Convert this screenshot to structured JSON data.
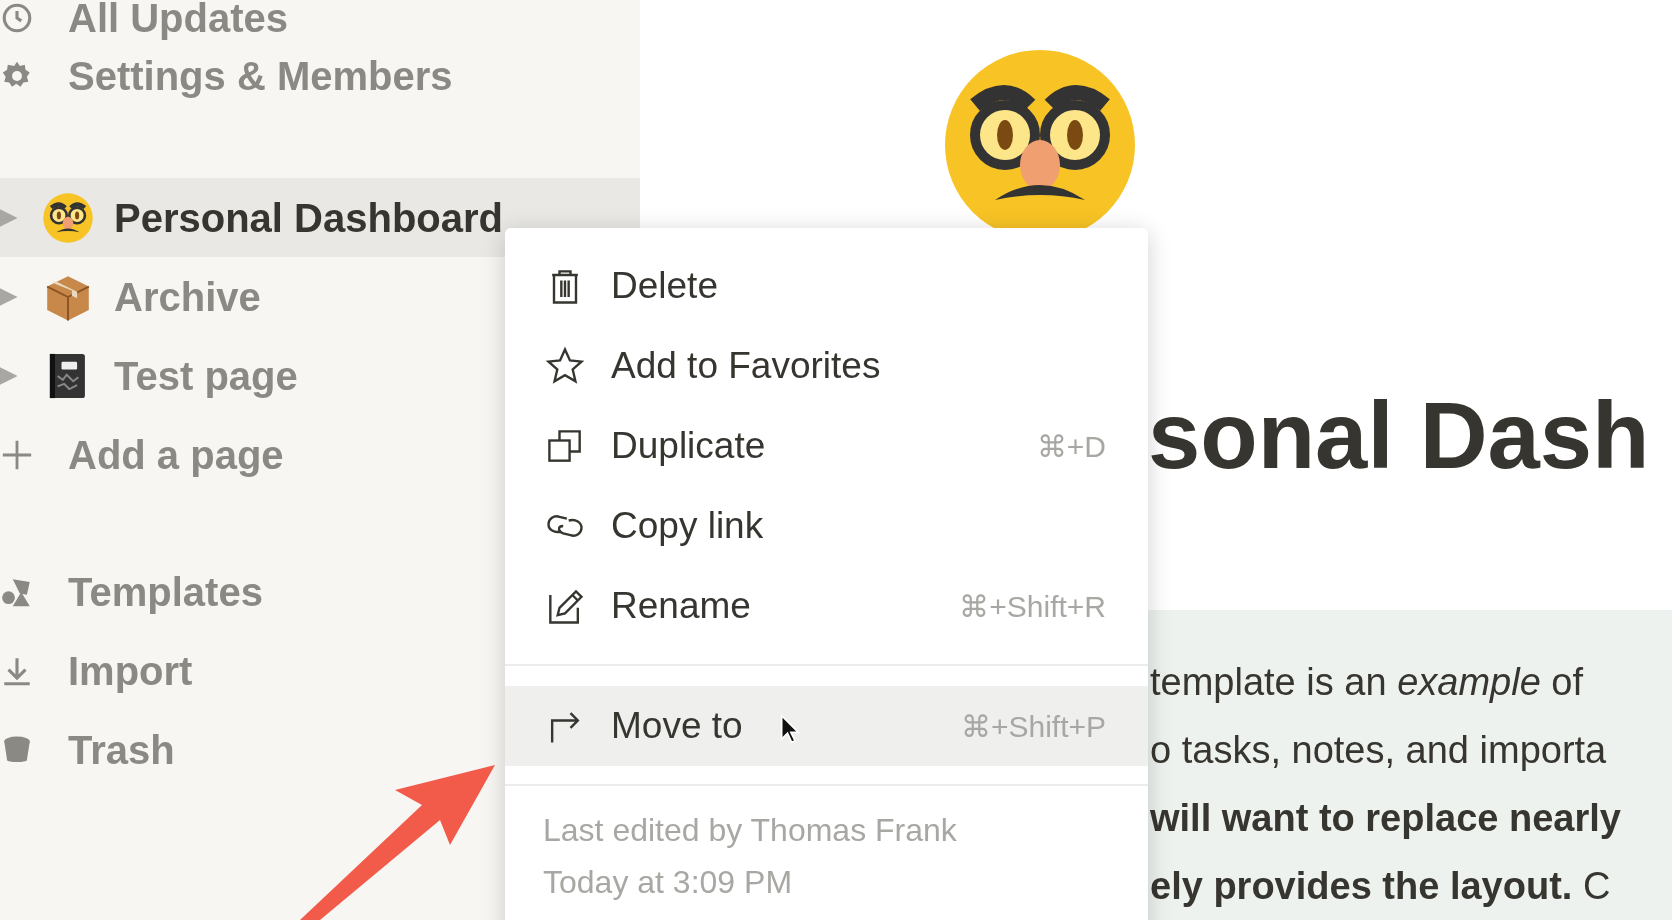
{
  "sidebar": {
    "top_item": {
      "kind": "clock",
      "label": "All Updates"
    },
    "nav_items": [
      {
        "kind": "gear",
        "label": "Settings & Members"
      }
    ],
    "pages": [
      {
        "kind": "disguise",
        "label": "Personal Dashboard",
        "selected": true
      },
      {
        "kind": "box",
        "label": "Archive",
        "selected": false
      },
      {
        "kind": "notebook",
        "label": "Test page",
        "selected": false
      }
    ],
    "add_page": {
      "label": "Add a page"
    },
    "bottom_items": [
      {
        "kind": "templates",
        "label": "Templates"
      },
      {
        "kind": "import",
        "label": "Import"
      },
      {
        "kind": "trash",
        "label": "Trash"
      }
    ]
  },
  "context_menu": {
    "sections": [
      [
        {
          "kind": "trash",
          "label": "Delete",
          "selected": false
        },
        {
          "kind": "star",
          "label": "Add to Favorites",
          "selected": false
        },
        {
          "kind": "duplicate",
          "label": "Duplicate",
          "shortcut": "⌘+D",
          "selected": false
        },
        {
          "kind": "link",
          "label": "Copy link",
          "selected": false
        },
        {
          "kind": "pencil",
          "label": "Rename",
          "shortcut": "⌘+Shift+R",
          "selected": false
        }
      ],
      [
        {
          "kind": "move",
          "label": "Move to",
          "shortcut": "⌘+Shift+P",
          "selected": true
        }
      ]
    ],
    "footer": [
      "Last edited by Thomas Frank",
      "Today at 3:09 PM"
    ]
  },
  "page": {
    "title": "sonal Dash",
    "callout": {
      "lines": [
        "template is an *example* of",
        "o tasks, notes, and importa",
        "**will want to replace nearly**",
        "**ely provides the layout.** C"
      ]
    }
  }
}
